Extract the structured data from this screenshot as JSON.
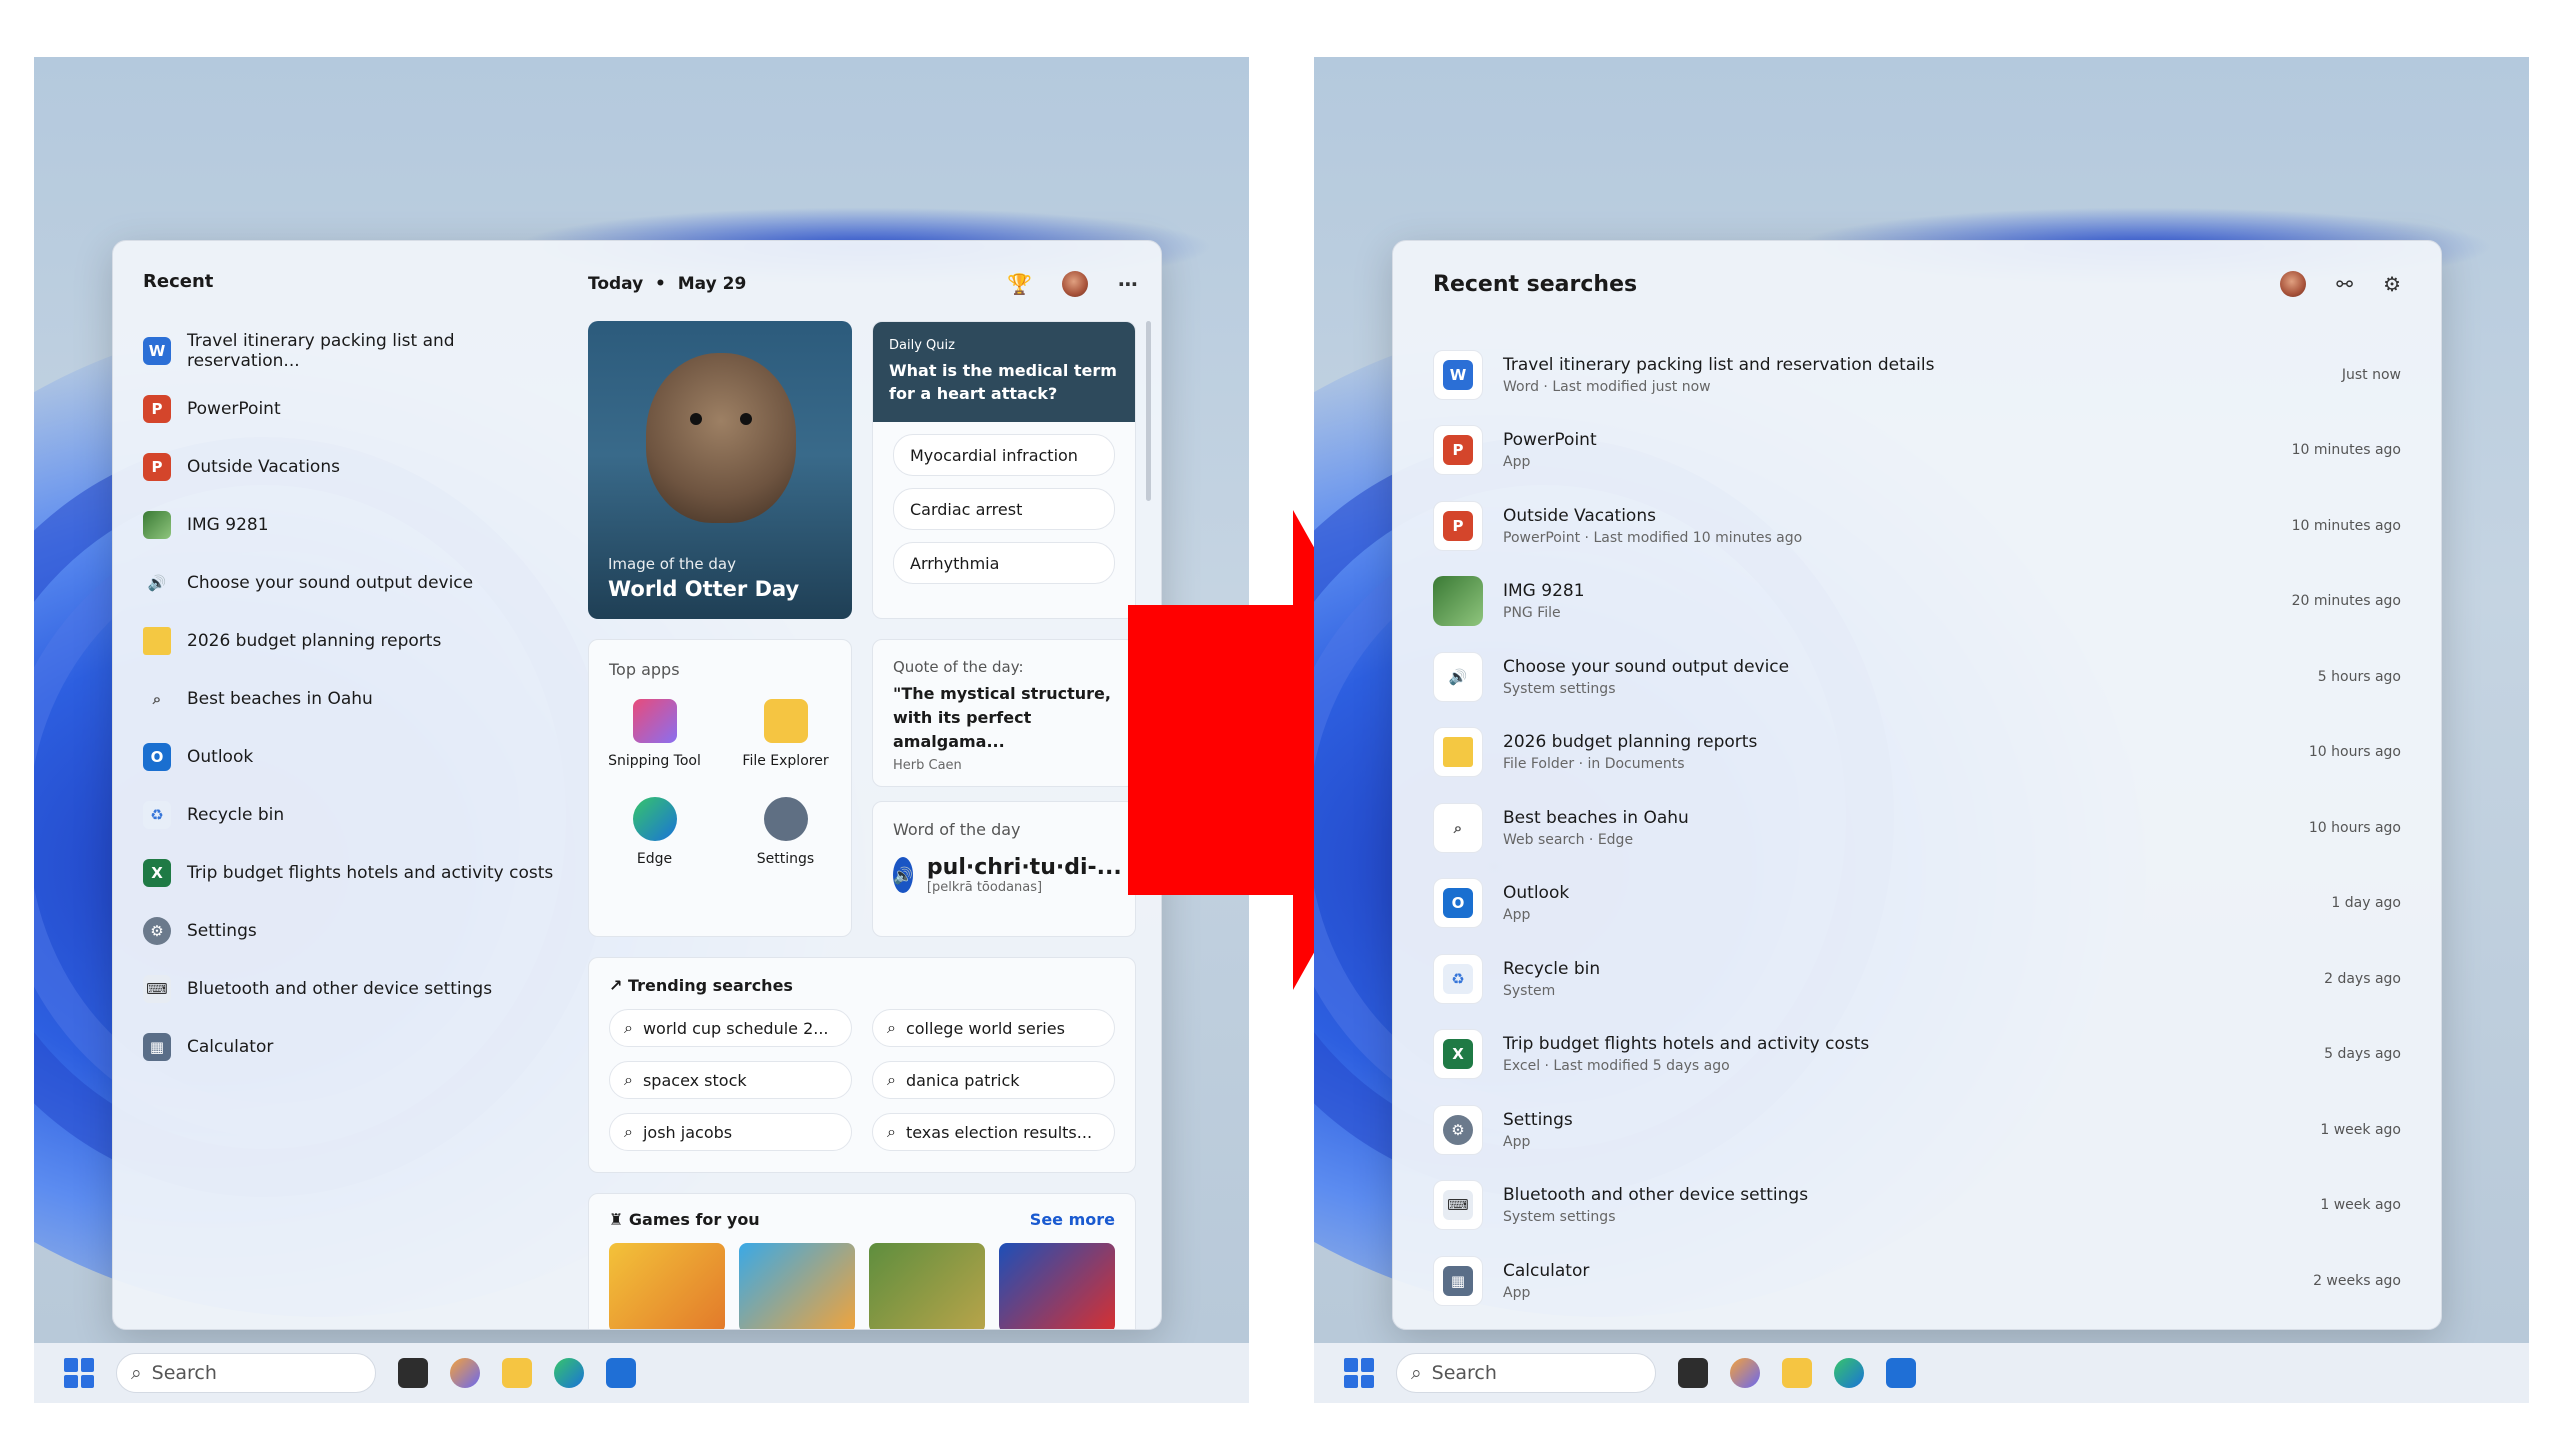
{
  "left": {
    "recent_title": "Recent",
    "recent_items": [
      {
        "label": "Travel itinerary packing list and reservation...",
        "icon": "word-doc-icon"
      },
      {
        "label": "PowerPoint",
        "icon": "powerpoint-icon"
      },
      {
        "label": "Outside Vacations",
        "icon": "powerpoint-file-icon"
      },
      {
        "label": "IMG 9281",
        "icon": "image-thumbnail-icon"
      },
      {
        "label": "Choose your sound output device",
        "icon": "speaker-icon"
      },
      {
        "label": "2026 budget planning reports",
        "icon": "folder-icon"
      },
      {
        "label": "Best beaches in Oahu",
        "icon": "search-icon"
      },
      {
        "label": "Outlook",
        "icon": "outlook-icon"
      },
      {
        "label": "Recycle bin",
        "icon": "recycle-bin-icon"
      },
      {
        "label": "Trip budget flights hotels and activity costs",
        "icon": "excel-icon"
      },
      {
        "label": "Settings",
        "icon": "gear-icon"
      },
      {
        "label": "Bluetooth and other device settings",
        "icon": "bluetooth-devices-icon"
      },
      {
        "label": "Calculator",
        "icon": "calculator-icon"
      }
    ],
    "today": "Today",
    "date": "May 29",
    "image_of_day_kicker": "Image of the day",
    "image_of_day_title": "World Otter Day",
    "quiz_kicker": "Daily Quiz",
    "quiz_question": "What is the medical term for a heart attack?",
    "quiz_options": [
      "Myocardial infraction",
      "Cardiac arrest",
      "Arrhythmia"
    ],
    "top_apps_title": "Top apps",
    "top_apps": [
      "Snipping Tool",
      "File Explorer",
      "Edge",
      "Settings"
    ],
    "quote_kicker": "Quote of the day:",
    "quote_text": "\"The mystical structure, with its perfect amalgama...",
    "quote_author": "Herb Caen",
    "word_kicker": "Word of the day",
    "word": "pul·chri·tu·di-...",
    "word_pron": "[pelkrā tōodanas]",
    "trending_title": "Trending searches",
    "trending": [
      "world cup schedule 2...",
      "college world series",
      "spacex stock",
      "danica patrick",
      "josh jacobs",
      "texas election results..."
    ],
    "games_title": "Games for you",
    "games_more": "See more",
    "taskbar_search": "Search"
  },
  "right": {
    "title": "Recent searches",
    "items": [
      {
        "name": "Travel itinerary packing list and reservation details",
        "sub": "Word · Last modified just now",
        "time": "Just now"
      },
      {
        "name": "PowerPoint",
        "sub": "App",
        "time": "10 minutes ago"
      },
      {
        "name": "Outside Vacations",
        "sub": "PowerPoint · Last modified 10 minutes ago",
        "time": "10 minutes ago"
      },
      {
        "name": "IMG 9281",
        "sub": "PNG File",
        "time": "20 minutes ago"
      },
      {
        "name": "Choose your sound output device",
        "sub": "System settings",
        "time": "5 hours ago"
      },
      {
        "name": "2026 budget planning reports",
        "sub": "File Folder · in Documents",
        "time": "10 hours ago"
      },
      {
        "name": "Best beaches in Oahu",
        "sub": "Web search · Edge",
        "time": "10 hours ago"
      },
      {
        "name": "Outlook",
        "sub": "App",
        "time": "1 day ago"
      },
      {
        "name": "Recycle bin",
        "sub": "System",
        "time": "2 days ago"
      },
      {
        "name": "Trip budget flights hotels and activity costs",
        "sub": "Excel · Last modified 5 days ago",
        "time": "5 days ago"
      },
      {
        "name": "Settings",
        "sub": "App",
        "time": "1 week ago"
      },
      {
        "name": "Bluetooth and other device settings",
        "sub": "System settings",
        "time": "1 week ago"
      },
      {
        "name": "Calculator",
        "sub": "App",
        "time": "2 weeks ago"
      }
    ],
    "taskbar_search": "Search"
  },
  "colors": {
    "accent": "#1a5ad0",
    "arrow": "#ff0000",
    "quiz_header": "#2e4a5c"
  }
}
